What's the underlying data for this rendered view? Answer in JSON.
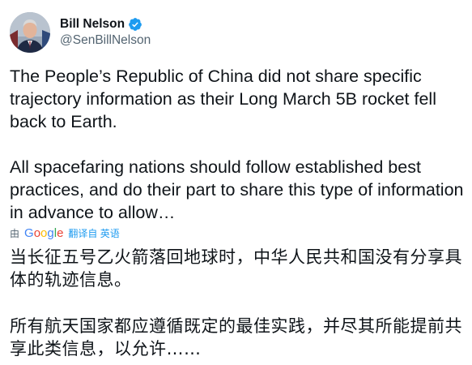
{
  "account": {
    "display_name": "Bill Nelson",
    "handle": "@SenBillNelson",
    "verified_color": "#1d9bf0"
  },
  "tweet": {
    "paragraph_1": "The People’s Republic of China did not share specific trajectory information as their Long March 5B rocket fell back to Earth.",
    "paragraph_2": "All spacefaring nations should follow established best practices, and do their part to share this type of information in advance to allow…"
  },
  "translation": {
    "by_label": "由",
    "provider": "Google",
    "link_label": "翻译自 英语",
    "paragraph_1": "当长征五号乙火箭落回地球时，中华人民共和国没有分享具体的轨迹信息。",
    "paragraph_2": "所有航天国家都应遵循既定的最佳实践，并尽其所能提前共享此类信息，以允许……"
  },
  "icons": {
    "verified": "verified-badge-icon",
    "avatar": "avatar-photo"
  },
  "colors": {
    "text_primary": "#0f1419",
    "text_secondary": "#536471",
    "link": "#1d9bf0"
  }
}
